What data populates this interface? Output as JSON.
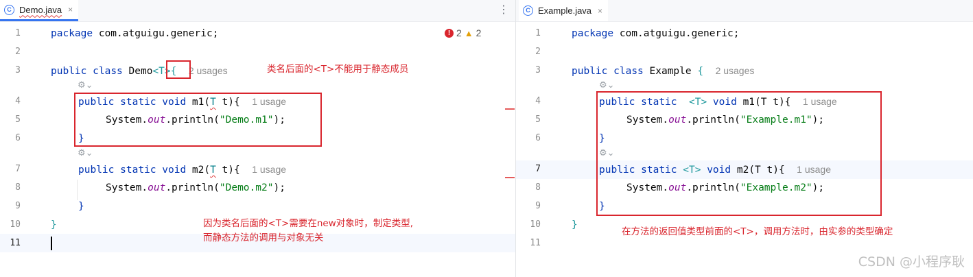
{
  "left": {
    "tab": {
      "label": "Demo.java",
      "icon": "class-c-icon",
      "close": "×"
    },
    "more": "⋮",
    "problems": {
      "errors": "2",
      "warnings": "2"
    },
    "lines": {
      "l1": [
        "package",
        " com.atguigu.generic;"
      ],
      "l3": [
        "public",
        " ",
        "class",
        " Demo",
        "<T>",
        "{",
        "2 usages"
      ],
      "l4": [
        "public",
        " ",
        "static",
        " ",
        "void",
        " m1(",
        "T",
        " t){",
        "1 usage"
      ],
      "l5": [
        "System.",
        "out",
        ".println(",
        "\"Demo.m1\"",
        ");"
      ],
      "l6": "}",
      "l7": [
        "public",
        " ",
        "static",
        " ",
        "void",
        " m2(",
        "T",
        " t){",
        "1 usage"
      ],
      "l8": [
        "System.",
        "out",
        ".println(",
        "\"Demo.m2\"",
        ");"
      ],
      "l9": "}",
      "l10": "}"
    },
    "notes": {
      "n1": "类名后面的<T>不能用于静态成员",
      "n2a": "因为类名后面的<T>需要在new对象时，制定类型,",
      "n2b": "而静态方法的调用与对象无关"
    }
  },
  "right": {
    "tab": {
      "label": "Example.java",
      "icon": "class-c-icon",
      "close": "×"
    },
    "lines": {
      "l1": [
        "package",
        " com.atguigu.generic;"
      ],
      "l3": [
        "public",
        " ",
        "class",
        " Example ",
        "{",
        "2 usages"
      ],
      "l4": [
        "public",
        " ",
        "static",
        "  ",
        "<T>",
        " ",
        "void",
        " m1(T t){",
        "1 usage"
      ],
      "l5": [
        "System.",
        "out",
        ".println(",
        "\"Example.m1\"",
        ");"
      ],
      "l6": "}",
      "l7": [
        "public",
        " ",
        "static",
        " ",
        "<T>",
        " ",
        "void",
        " m2(T t){",
        "1 usage"
      ],
      "l8": [
        "System.",
        "out",
        ".println(",
        "\"Example.m2\"",
        ");"
      ],
      "l9": "}",
      "l10": "}"
    },
    "notes": {
      "n1": "在方法的返回值类型前面的<T>，调用方法时，由实参的类型确定"
    }
  },
  "line_numbers": [
    "1",
    "2",
    "3",
    "4",
    "5",
    "6",
    "7",
    "8",
    "9",
    "10",
    "11"
  ],
  "gear_glyph": "⚙⌄",
  "watermark": "CSDN @小程序耿",
  "colors": {
    "keyword": "#0033b3",
    "string": "#067d17",
    "static_field": "#871094",
    "annotation_red": "#d9252d",
    "tab_accent": "#3574f0"
  }
}
